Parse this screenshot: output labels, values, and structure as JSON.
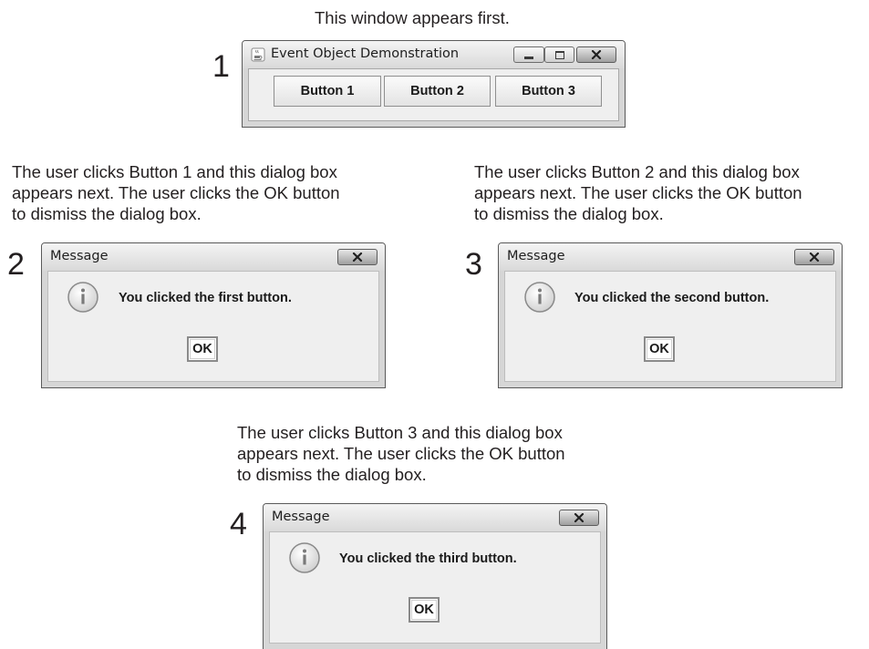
{
  "captions": {
    "first": "This window appears first.",
    "step2": [
      "The user clicks Button 1 and this dialog box",
      "appears next. The user clicks the OK button",
      "to dismiss the dialog box."
    ],
    "step3": [
      "The user clicks Button 2 and this dialog box",
      "appears next. The user clicks the OK button",
      "to dismiss the dialog box."
    ],
    "step4": [
      "The user clicks Button 3 and this dialog box",
      "appears next. The user clicks the OK button",
      "to dismiss the dialog box."
    ]
  },
  "step_numbers": [
    "1",
    "2",
    "3",
    "4"
  ],
  "main_window": {
    "title": "Event Object Demonstration",
    "buttons": [
      "Button 1",
      "Button 2",
      "Button 3"
    ],
    "icon": "java-cup-icon"
  },
  "dialogs": [
    {
      "title": "Message",
      "message": "You clicked the first button.",
      "ok_label": "OK",
      "icon": "info-icon"
    },
    {
      "title": "Message",
      "message": "You clicked the second button.",
      "ok_label": "OK",
      "icon": "info-icon"
    },
    {
      "title": "Message",
      "message": "You clicked the third button.",
      "ok_label": "OK",
      "icon": "info-icon"
    }
  ]
}
